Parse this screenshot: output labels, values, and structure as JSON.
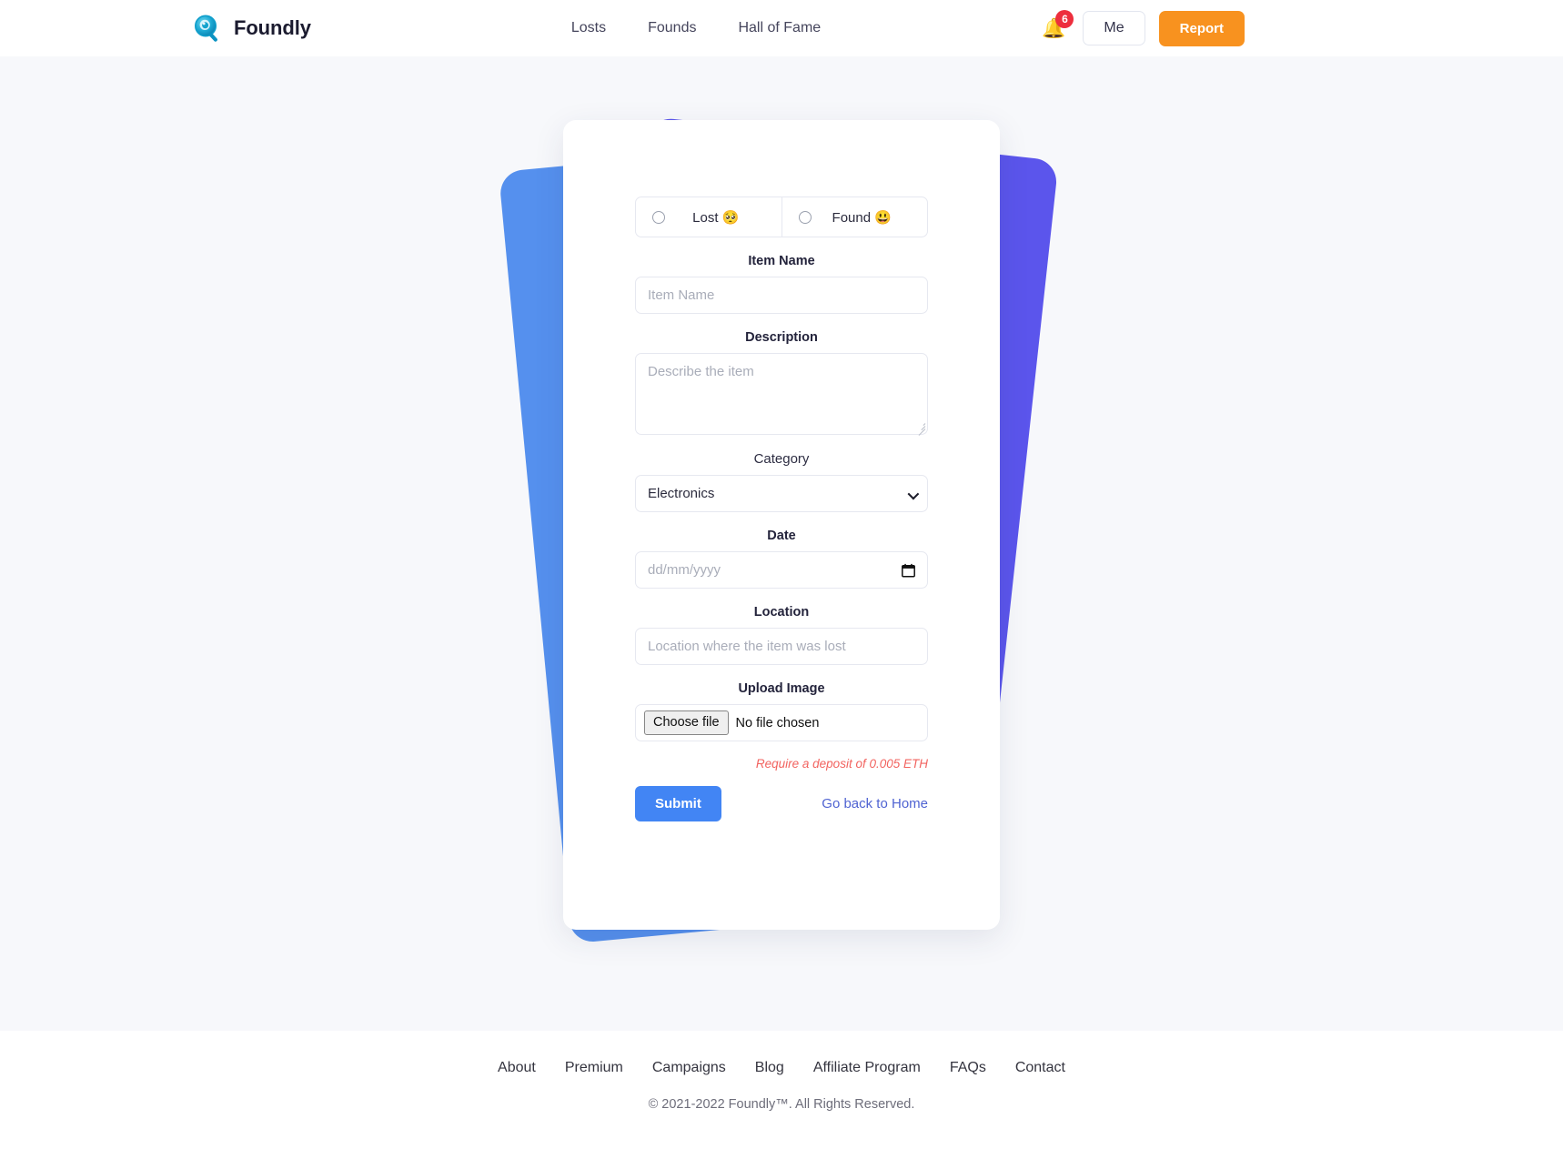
{
  "header": {
    "brand": {
      "name": "Foundly",
      "logo_icon": "magnifier-logo-icon"
    },
    "nav": [
      {
        "label": "Losts"
      },
      {
        "label": "Founds"
      },
      {
        "label": "Hall of Fame"
      }
    ],
    "notifications": {
      "icon": "bell-icon",
      "glyph": "🔔",
      "count": "6",
      "badge_color": "#ed2e3d"
    },
    "me_label": "Me",
    "report_label": "Report",
    "report_color": "#f8921f"
  },
  "form": {
    "type_options": [
      {
        "label": "Lost",
        "emoji": "🥺",
        "selected": false
      },
      {
        "label": "Found",
        "emoji": "😃",
        "selected": false
      }
    ],
    "item_name": {
      "label": "Item Name",
      "placeholder": "Item Name",
      "value": ""
    },
    "description": {
      "label": "Description",
      "placeholder": "Describe the item",
      "value": ""
    },
    "category": {
      "label": "Category",
      "selected": "Electronics",
      "options": [
        "Electronics"
      ],
      "chevron_icon": "chevron-down-icon"
    },
    "date": {
      "label": "Date",
      "placeholder": "dd/mm/yyyy",
      "value": "",
      "icon": "calendar-icon"
    },
    "location": {
      "label": "Location",
      "placeholder": "Location where the item was lost",
      "value": ""
    },
    "upload": {
      "label": "Upload Image",
      "button_label": "Choose file",
      "status": "No file chosen"
    },
    "deposit_notice": "Require a deposit of 0.005 ETH",
    "deposit_color": "#f2635f",
    "submit_label": "Submit",
    "submit_color": "#4285f4",
    "home_link_label": "Go back to Home"
  },
  "decor": {
    "indigo": "#5b55ec",
    "blue": "#5590ee",
    "page_background": "#f7f8fb"
  },
  "footer": {
    "links": [
      {
        "label": "About"
      },
      {
        "label": "Premium"
      },
      {
        "label": "Campaigns"
      },
      {
        "label": "Blog"
      },
      {
        "label": "Affiliate Program"
      },
      {
        "label": "FAQs"
      },
      {
        "label": "Contact"
      }
    ],
    "copyright": "© 2021-2022 Foundly™. All Rights Reserved."
  }
}
